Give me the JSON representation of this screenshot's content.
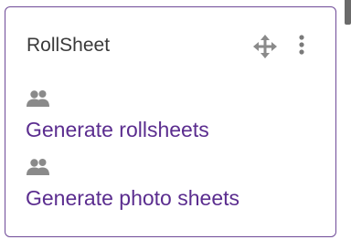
{
  "block": {
    "title": "RollSheet",
    "move_icon": "move-arrows-icon",
    "menu_icon": "kebab-menu-icon"
  },
  "links": [
    {
      "icon": "users-icon",
      "label": "Generate rollsheets"
    },
    {
      "icon": "users-icon",
      "label": "Generate photo sheets"
    }
  ],
  "colors": {
    "border": "#6f4a98",
    "link": "#5b2d8f",
    "title": "#3a3a3a",
    "icon": "#8a8a8a"
  }
}
